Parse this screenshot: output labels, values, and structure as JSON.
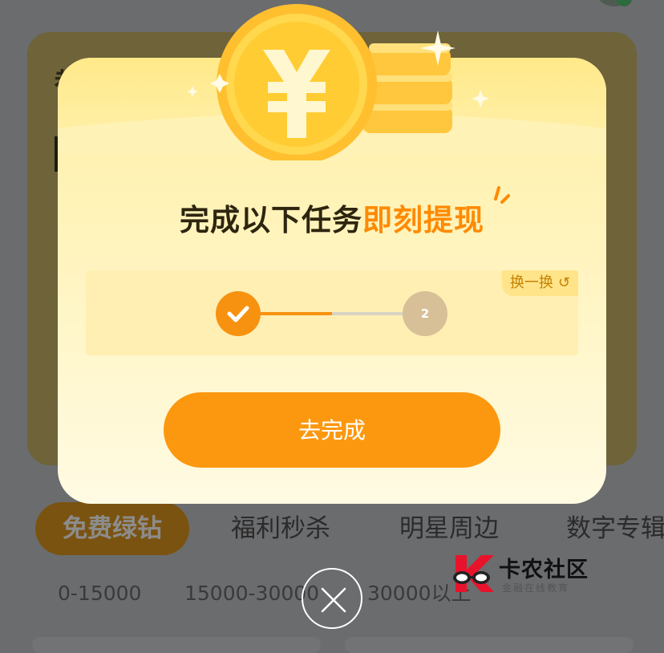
{
  "background": {
    "card_glyph": "都",
    "tabs": [
      {
        "label": "免费绿钻",
        "active": true
      },
      {
        "label": "福利秒杀",
        "active": false
      },
      {
        "label": "明星周边",
        "active": false
      },
      {
        "label": "数字专辑",
        "active": false
      }
    ],
    "ranges": [
      "0-15000",
      "15000-30000",
      "30000以上"
    ]
  },
  "modal": {
    "headline_main": "完成以下任务",
    "headline_accent": "即刻提现",
    "refresh_label": "换一换",
    "refresh_icon": "refresh-icon",
    "steps": [
      {
        "label": "",
        "state": "done",
        "icon": "check-icon"
      },
      {
        "label": "2",
        "state": "pending"
      }
    ],
    "progress_fraction": 0.5,
    "cta_label": "去完成",
    "close_icon": "close-icon"
  },
  "watermark": {
    "title": "卡农社区",
    "subtitle": "金融在线教育"
  },
  "colors": {
    "accent": "#fc980f",
    "accent_text": "#ff8a00",
    "step_pending": "#d7bf97",
    "modal_bg": "#fff4bf"
  }
}
